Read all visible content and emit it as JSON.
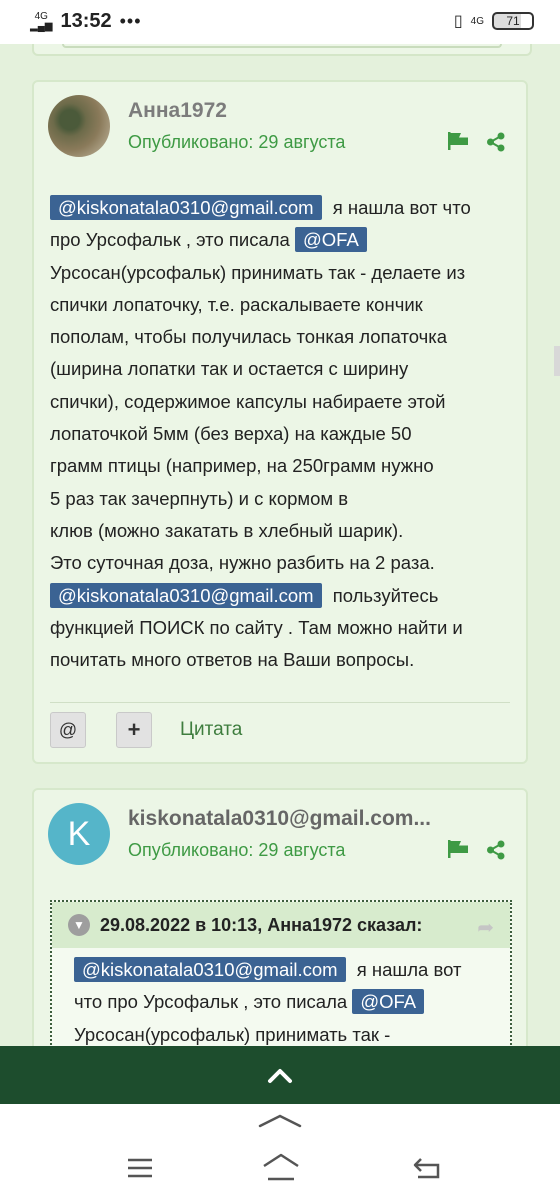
{
  "status_bar": {
    "network_left": "4G",
    "time": "13:52",
    "dots": "•••",
    "network_right": "4G",
    "battery": "71"
  },
  "posts": [
    {
      "author": "Анна1972",
      "published": "Опубликовано: 29 августа",
      "body_lines": [
        {
          "mention": "@kiskonatala0310@gmail.com",
          "text": " я нашла вот что"
        },
        {
          "text": "про Урсофальк , это писала ",
          "mention_end": "@OFA"
        },
        {
          "text": "Урсосан(урсофальк) принимать так - делаете из"
        },
        {
          "text": "спички лопаточку, т.е. раскалываете кончик"
        },
        {
          "text": "пополам, чтобы получилась тонкая лопаточка"
        },
        {
          "text": "(ширина лопатки так и остается с ширину"
        },
        {
          "text": "спички), содержимое капсулы набираете этой"
        },
        {
          "text": "лопаточкой 5мм (без верха) на каждые 50"
        },
        {
          "text": "грамм птицы (например, на 250грамм нужно"
        },
        {
          "text": "5 раз так зачерпнуть) и с кормом в"
        },
        {
          "text": "клюв (можно закатать в хлебный шарик)."
        },
        {
          "text": "Это суточная доза, нужно разбить на 2 раза."
        },
        {
          "mention": "@kiskonatala0310@gmail.com",
          "text": " пользуйтесь"
        },
        {
          "text": "функцией ПОИСК по сайту . Там можно найти и"
        },
        {
          "text": "почитать много ответов на Ваши вопросы."
        }
      ],
      "actions": {
        "mention_btn": "@",
        "add_btn": "+",
        "quote": "Цитата"
      }
    },
    {
      "author": "kiskonatala0310@gmail.com...",
      "avatar_letter": "K",
      "published": "Опубликовано: 29 августа",
      "quote_header": "29.08.2022 в 10:13, Анна1972 сказал:",
      "quote_lines": [
        {
          "mention": "@kiskonatala0310@gmail.com",
          "text": " я нашла вот"
        },
        {
          "text": "что про Урсофальк , это писала ",
          "mention_end": "@OFA"
        },
        {
          "text": "Урсосан(урсофальк) принимать так -"
        }
      ]
    }
  ],
  "colors": {
    "page_bg": "#e4f1dc",
    "post_bg": "#ecf6e6",
    "accent_green": "#3e9a44",
    "mention_bg": "#3b6393",
    "scroll_bar": "#1d4d2d",
    "avatar_k": "#55b5c9"
  }
}
